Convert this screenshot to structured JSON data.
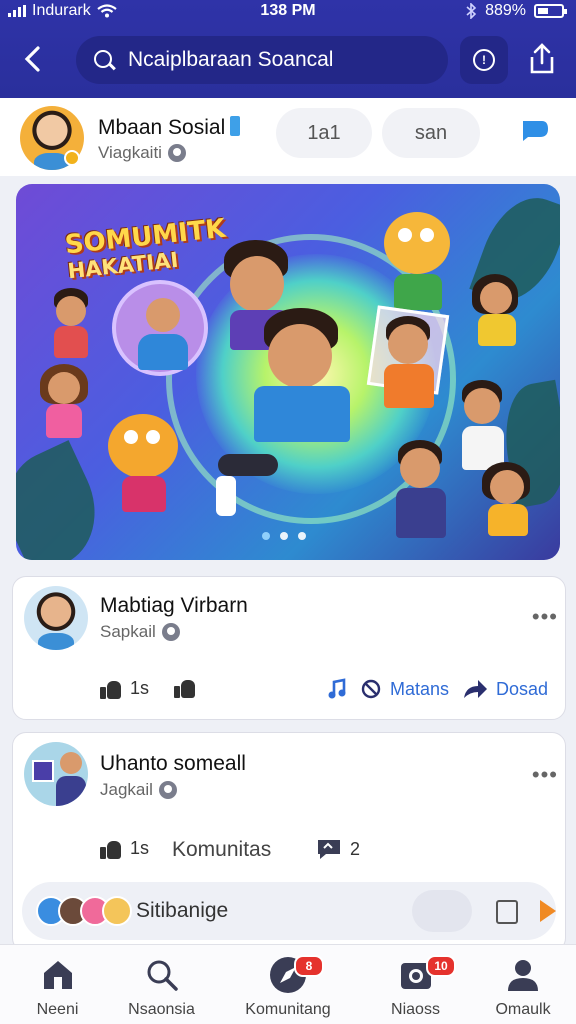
{
  "status_bar": {
    "carrier": "Indurark",
    "time": "138 PM",
    "battery": "889%"
  },
  "header": {
    "search_text": "Ncaiplbaraan Soancal"
  },
  "profile": {
    "name": "Mbaan Sosial",
    "sub": "Viagkaiti",
    "pill_1": "1a1",
    "pill_2": "san"
  },
  "hero": {
    "title_line1": "SOMUMITK",
    "title_line2": "HAKATIAI",
    "slides": 3,
    "active_slide": 1
  },
  "post_1": {
    "name": "Mabtiag Virbarn",
    "sub": "Sapkail",
    "more": "•••",
    "like_count": "1s",
    "action_3": "Matans",
    "action_4": "Dosad"
  },
  "post_2": {
    "name": "Uhanto someall",
    "sub": "Jagkail",
    "more": "•••",
    "like_count": "1s",
    "action_2": "Komunitas",
    "comment_count": "2"
  },
  "comment_bar": {
    "placeholder": "Sitibanige"
  },
  "nav": {
    "items": [
      {
        "label": "Neeni"
      },
      {
        "label": "Nsaonsia"
      },
      {
        "label": "Komunitang",
        "badge": "8"
      },
      {
        "label": "Niaoss",
        "badge": "10"
      },
      {
        "label": "Omaulk"
      }
    ]
  },
  "colors": {
    "header": "#2f33a8",
    "accent_blue": "#2f6bd6",
    "badge_red": "#e5322d",
    "send_orange": "#f08a24"
  }
}
